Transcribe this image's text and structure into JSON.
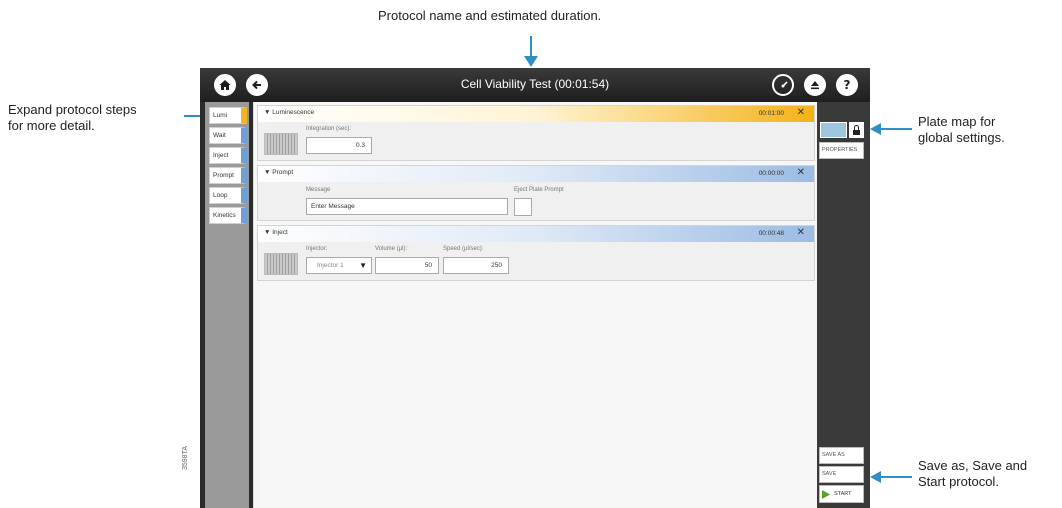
{
  "callouts": {
    "top": "Protocol name and estimated duration.",
    "left_line1": "Expand protocol steps",
    "left_line2": "for more detail.",
    "right_top_line1": "Plate map for",
    "right_top_line2": "global settings.",
    "right_bottom_line1": "Save as, Save and",
    "right_bottom_line2": "Start protocol."
  },
  "app": {
    "title": "Cell Viability Test (00:01:54)",
    "home_icon": "home-icon",
    "back_icon": "back-arrow-icon",
    "gauge_icon": "gauge-icon",
    "eject_icon": "eject-icon",
    "help_icon": "help-icon",
    "help_glyph": "?"
  },
  "sidebar": {
    "tabs": [
      {
        "label": "Lumi"
      },
      {
        "label": "Wait"
      },
      {
        "label": "Inject"
      },
      {
        "label": "Prompt"
      },
      {
        "label": "Loop"
      },
      {
        "label": "Kinetics"
      }
    ]
  },
  "steps": {
    "lumi": {
      "name": "Luminescence",
      "time": "00:01:00",
      "integration_label": "Integration (sec):",
      "integration_value": "0.3"
    },
    "prompt": {
      "name": "Prompt",
      "time": "00:00:00",
      "message_label": "Message",
      "message_value": "Enter Message",
      "eject_label": "Eject Plate Prompt"
    },
    "inject": {
      "name": "Inject",
      "time": "00:00:48",
      "injector_label": "Injector:",
      "injector_value": "Injector 1",
      "volume_label": "Volume (µl):",
      "volume_value": "50",
      "speed_label": "Speed (µl/sec):",
      "speed_value": "250"
    }
  },
  "right_panel": {
    "properties_label": "PROPERTIES",
    "save_as_label": "SAVE AS",
    "save_label": "SAVE",
    "start_label": "START",
    "plate_map_color": "#9ec7df"
  },
  "close_glyph": "✕",
  "expand_glyph": "▼",
  "side_code": "3598TA",
  "colors": {
    "accent_blue": "#2f8fc4",
    "lumi_orange": "#f4b218",
    "start_green": "#5aa02c"
  }
}
